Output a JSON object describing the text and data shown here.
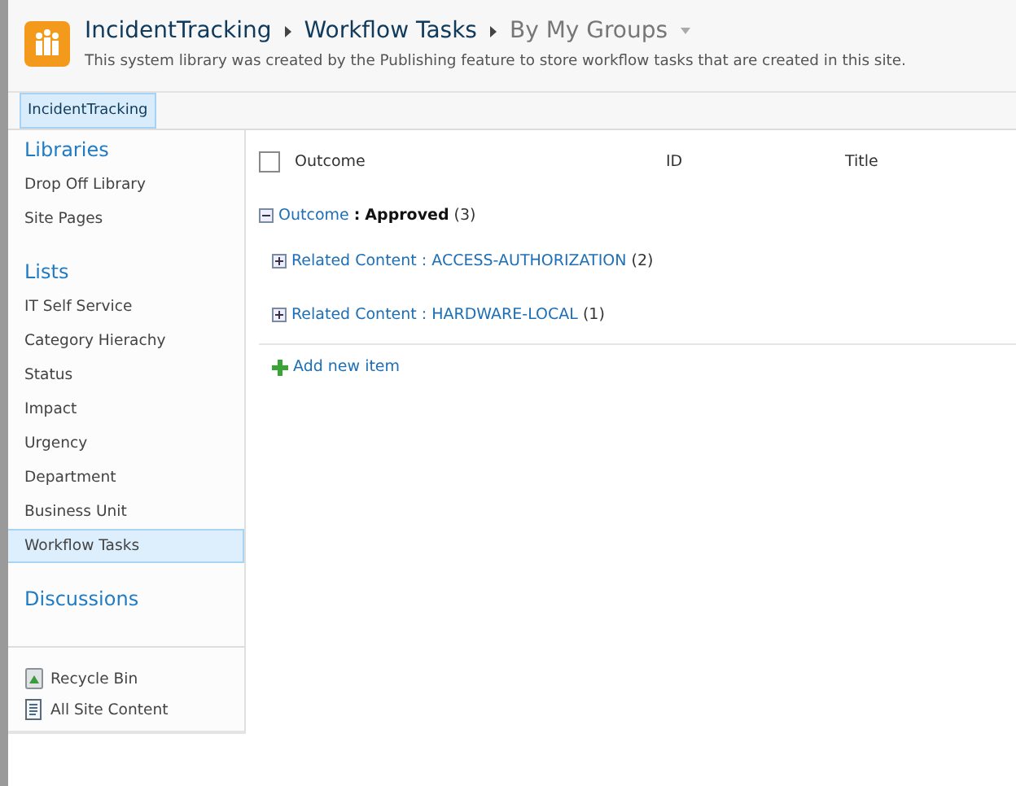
{
  "header": {
    "breadcrumb": [
      {
        "label": "IncidentTracking",
        "kind": "link"
      },
      {
        "label": "Workflow Tasks",
        "kind": "link"
      },
      {
        "label": "By My Groups",
        "kind": "view"
      }
    ],
    "description": "This system library was created by the Publishing feature to store workflow tasks that are created in this site."
  },
  "top_nav": [
    {
      "label": "IncidentTracking",
      "selected": true
    }
  ],
  "sidebar": {
    "sections": [
      {
        "heading": "Libraries",
        "items": [
          {
            "label": "Drop Off Library",
            "selected": false
          },
          {
            "label": "Site Pages",
            "selected": false
          }
        ]
      },
      {
        "heading": "Lists",
        "items": [
          {
            "label": "IT Self Service",
            "selected": false
          },
          {
            "label": "Category Hierachy",
            "selected": false
          },
          {
            "label": "Status",
            "selected": false
          },
          {
            "label": "Impact",
            "selected": false
          },
          {
            "label": "Urgency",
            "selected": false
          },
          {
            "label": "Department",
            "selected": false
          },
          {
            "label": "Business Unit",
            "selected": false
          },
          {
            "label": "Workflow Tasks",
            "selected": true
          }
        ]
      },
      {
        "heading": "Discussions"
      }
    ],
    "footer": [
      {
        "label": "Recycle Bin",
        "kind": "bin"
      },
      {
        "label": "All Site Content",
        "kind": "content"
      }
    ]
  },
  "table": {
    "columns": [
      "Outcome",
      "ID",
      "Title"
    ],
    "select_all": {
      "checked": false
    },
    "group": {
      "field": "Outcome",
      "separator": ":",
      "value": "Approved",
      "count": "(3)",
      "expanded": true,
      "subgroups": [
        {
          "label": "Related Content : ACCESS-AUTHORIZATION",
          "count": "(2)",
          "expanded": false
        },
        {
          "label": "Related Content : HARDWARE-LOCAL",
          "count": "(1)",
          "expanded": false
        }
      ]
    },
    "add_item": "Add new item"
  }
}
